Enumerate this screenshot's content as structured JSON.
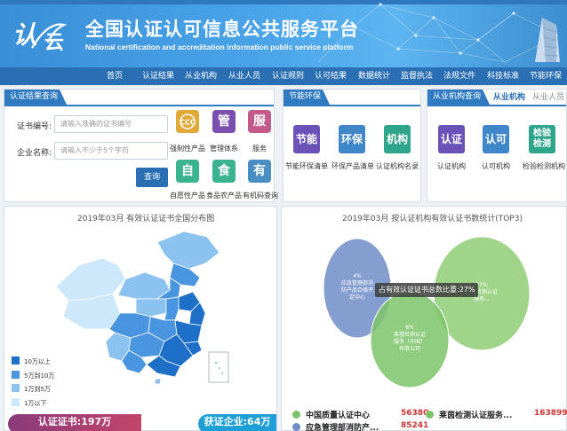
{
  "header": {
    "logo_text_a": "认",
    "logo_text_b": "云",
    "title": "全国认证认可信息公共服务平台",
    "subtitle": "National certification and accreditation information public service platform"
  },
  "nav": [
    "首页",
    "认证结果",
    "从业机构",
    "从业人员",
    "认证规则",
    "认可结果",
    "数据统计",
    "监督执法",
    "法规文件",
    "科技标准",
    "节能环保"
  ],
  "search_panel": {
    "tab": "认证结果查询",
    "cert_label": "证书编号:",
    "cert_placeholder": "请输入准确的证书编号",
    "company_label": "企业名称:",
    "company_placeholder": "请输入不少于5个字符",
    "query_button": "查询",
    "icons": [
      {
        "char": "CCC",
        "label": "强制性产品",
        "color": "#e0a93a"
      },
      {
        "char": "管",
        "label": "管理体系",
        "color": "#7a4fb0"
      },
      {
        "char": "服",
        "label": "服务",
        "color": "#c45a8a"
      },
      {
        "char": "自",
        "label": "自愿性产品",
        "color": "#3bb38f"
      },
      {
        "char": "食",
        "label": "食品农产品",
        "color": "#3bb38f"
      },
      {
        "char": "有",
        "label": "有机码查询",
        "color": "#4a8fc4"
      }
    ]
  },
  "energy_panel": {
    "tab": "节能环保",
    "tiles": [
      {
        "text": "节能",
        "label": "节能环保清单",
        "color": "#6a52b8"
      },
      {
        "text": "环保",
        "label": "环保产品清单",
        "color": "#3f87c8"
      },
      {
        "text": "机构",
        "label": "认证机构名录",
        "color": "#2fa58c"
      }
    ]
  },
  "org_panel": {
    "tab_active": "从业机构查询",
    "tab_other_1": "从业机构",
    "tab_other_2": "从业人员",
    "tiles": [
      {
        "text": "认证",
        "label": "认证机构",
        "color": "#6a52b8"
      },
      {
        "text": "认可",
        "label": "认可机构",
        "color": "#3f87c8"
      },
      {
        "text": "检验检测",
        "label": "检验检测机构",
        "color": "#2fa58c"
      }
    ]
  },
  "map_panel": {
    "title": "2019年03月  有效认证证书全国分布图",
    "legend": [
      {
        "label": "10万以上",
        "color": "#1e6fc8"
      },
      {
        "label": "5万到10万",
        "color": "#4a95df"
      },
      {
        "label": "1万到5万",
        "color": "#8cc2ef"
      },
      {
        "label": "1万以下",
        "color": "#cde8fa"
      }
    ],
    "stat_cert": "认证证书:197万",
    "stat_company": "获证企业:64万"
  },
  "pie_panel": {
    "title": "2019年03月  按认证机构有效认证书数统计(TOP3)",
    "tooltip": "占有效认证证书总数比重:27%",
    "bubble_labels": [
      "4%\n应急管理部消\n防产品合格评\n定中心",
      "27%\n莱茵检测认证\n服务...",
      "8%\n莱茵检测认证\n服务（中国）\n有限公司"
    ],
    "legend": [
      {
        "name": "中国质量认证中心",
        "value": "56380",
        "color": "#7cc46a"
      },
      {
        "name": "莱茵检测认证服务...",
        "value": "163899",
        "color": "#7cc46a"
      },
      {
        "name": "应急管理部消防产...",
        "value": "85241",
        "color": "#6f8dc8"
      }
    ]
  },
  "chart_data": {
    "type": "scatter",
    "title": "2019年03月  按认证机构有效认证书数统计(TOP3)",
    "series": [
      {
        "name": "应急管理部消防产品合格评定中心",
        "percent": 4
      },
      {
        "name": "莱茵检测认证服务",
        "percent": 27
      },
      {
        "name": "莱茵检测认证服务（中国）有限公司",
        "percent": 8
      }
    ]
  }
}
